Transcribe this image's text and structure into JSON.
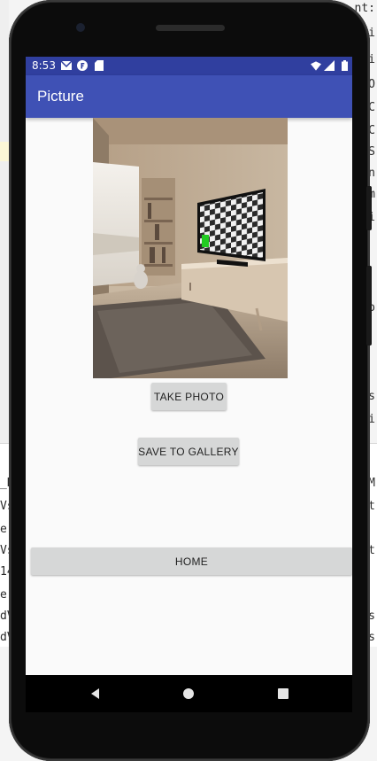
{
  "ide": {
    "right_fragments": [
      "nt:",
      "ti",
      "i",
      "O",
      "C",
      "C",
      "S",
      "n",
      "m",
      "i",
      "o",
      "s",
      "i",
      "EM",
      "st",
      "st",
      "es",
      "es"
    ],
    "left_fragments": [
      "_H",
      "Vs",
      "e",
      "Vs",
      "14",
      "e",
      "dV",
      "dV"
    ]
  },
  "status_bar": {
    "time": "8:53",
    "icons": [
      "gmail-icon",
      "f-icon",
      "sd-card-icon",
      "wifi-icon",
      "signal-icon",
      "battery-icon"
    ]
  },
  "app_bar": {
    "title": "Picture"
  },
  "photo": {
    "description_icon": "captured-photo-image"
  },
  "buttons": {
    "take_photo": "TAKE PHOTO",
    "save_to_gallery": "SAVE TO GALLERY",
    "home": "HOME"
  },
  "nav_bar": {
    "icons": [
      "back-icon",
      "home-circle-icon",
      "recents-icon"
    ]
  },
  "colors": {
    "status_bar": "#303f9f",
    "app_bar": "#3f51b5",
    "screen_bg": "#fafafa",
    "button_bg": "#d6d7d7"
  }
}
